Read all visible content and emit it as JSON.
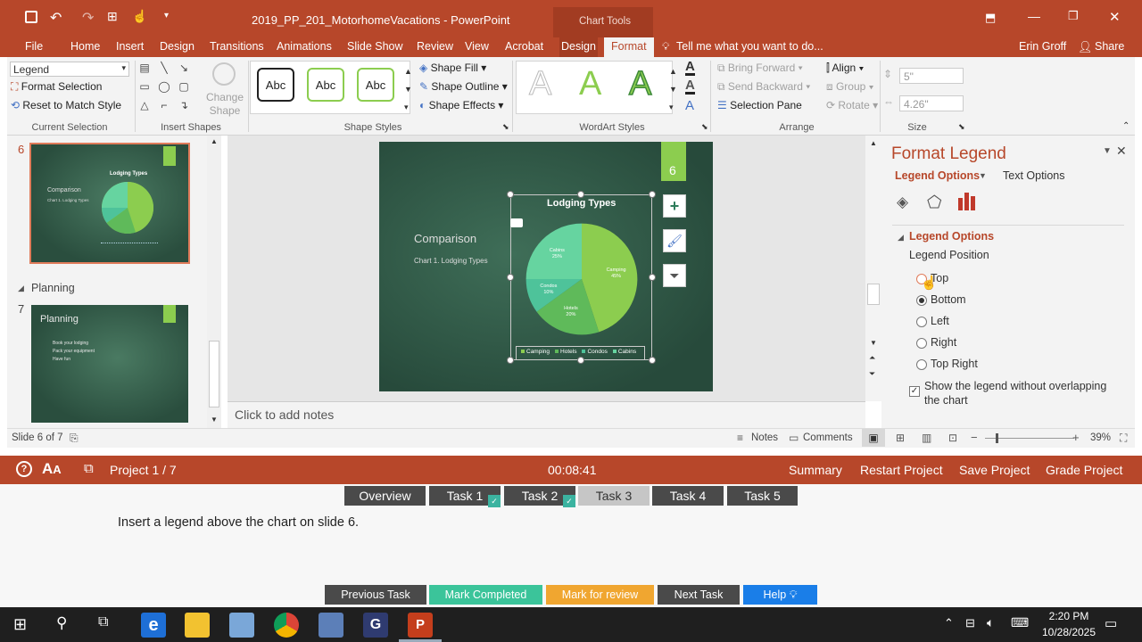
{
  "window": {
    "title": "2019_PP_201_MotorhomeVacations - PowerPoint",
    "chart_tools": "Chart Tools",
    "user": "Erin Groff",
    "share": "Share"
  },
  "tabs": [
    "File",
    "Home",
    "Insert",
    "Design",
    "Transitions",
    "Animations",
    "Slide Show",
    "Review",
    "View",
    "Acrobat",
    "Design",
    "Format"
  ],
  "tell_me": "Tell me what you want to do...",
  "ribbon": {
    "selection_dropdown": "Legend",
    "format_selection": "Format Selection",
    "reset_style": "Reset to Match Style",
    "current_selection": "Current Selection",
    "change_shape": "Change Shape",
    "insert_shapes": "Insert Shapes",
    "abc": "Abc",
    "shape_fill": "Shape Fill",
    "shape_outline": "Shape Outline",
    "shape_effects": "Shape Effects",
    "shape_styles": "Shape Styles",
    "wordart_styles": "WordArt Styles",
    "bring_forward": "Bring Forward",
    "send_backward": "Send Backward",
    "selection_pane": "Selection Pane",
    "align": "Align",
    "group": "Group",
    "rotate": "Rotate",
    "arrange": "Arrange",
    "height": "5\"",
    "width": "4.26\"",
    "size": "Size"
  },
  "thumbnails": {
    "slide6_num": "6",
    "slide6_title": "Comparison",
    "slide6_sub": "Chart 1.  Lodging Types",
    "slide6_chart": "Lodging Types",
    "section": "Planning",
    "slide7_num": "7",
    "slide7_title": "Planning",
    "slide7_bullets": [
      "Book your lodging",
      "Pack your equipment",
      "Have fun"
    ]
  },
  "slide": {
    "number": "6",
    "title": "Comparison",
    "subtitle": "Chart 1.  Lodging Types",
    "chart_title": "Lodging Types"
  },
  "chart_data": {
    "type": "pie",
    "title": "Lodging Types",
    "categories": [
      "Camping",
      "Hotels",
      "Condos",
      "Cabins"
    ],
    "values": [
      45,
      20,
      10,
      25
    ],
    "labels": [
      "Camping\n45%",
      "Hotels\n20%",
      "Condos\n10%",
      "Cabins\n25%"
    ],
    "legend": "bottom",
    "colors": [
      "#8ccd4f",
      "#5fba5a",
      "#4ec39a",
      "#66d4a0"
    ]
  },
  "notes_placeholder": "Click to add notes",
  "format_pane": {
    "title": "Format Legend",
    "tab_legend": "Legend Options",
    "tab_text": "Text Options",
    "section": "Legend Options",
    "position_label": "Legend Position",
    "options": [
      "Top",
      "Bottom",
      "Left",
      "Right",
      "Top Right"
    ],
    "selected": "Bottom",
    "overlap": "Show the legend without overlapping the chart"
  },
  "status": {
    "slide_of": "Slide 6 of 7",
    "notes": "Notes",
    "comments": "Comments",
    "zoom": "39%"
  },
  "project": {
    "name": "Project 1 / 7",
    "timer": "00:08:41",
    "summary": "Summary",
    "restart": "Restart Project",
    "save": "Save Project",
    "grade": "Grade Project"
  },
  "task_tabs": [
    "Overview",
    "Task 1",
    "Task 2",
    "Task 3",
    "Task 4",
    "Task 5"
  ],
  "task_text": "Insert a legend above the chart on slide 6.",
  "bottom_buttons": {
    "previous": "Previous Task",
    "completed": "Mark Completed",
    "review": "Mark for review",
    "next": "Next Task",
    "help": "Help"
  },
  "taskbar": {
    "time": "2:20 PM",
    "date": "10/28/2025"
  },
  "colors": {
    "accent": "#b7472a",
    "slide_bg": "#2f5d4a",
    "green": "#8ccd4f"
  }
}
